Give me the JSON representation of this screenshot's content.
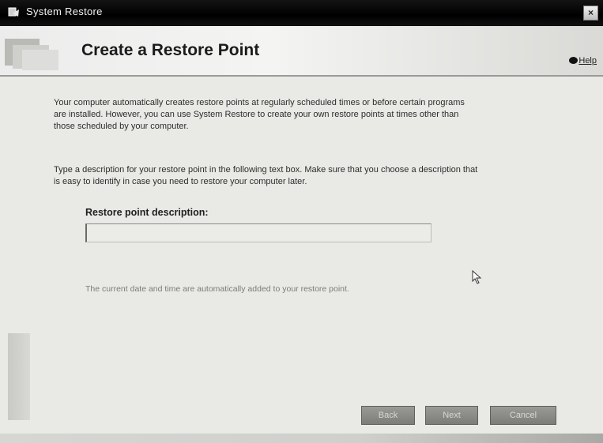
{
  "window": {
    "title": "System Restore",
    "close_label": "×"
  },
  "header": {
    "title": "Create a Restore Point",
    "help_label": "Help"
  },
  "main": {
    "intro_text": "Your computer automatically creates restore points at regularly scheduled times or before certain programs are installed. However, you can use System Restore to create your own restore points at times other than those scheduled by your computer.",
    "instructions_text": "Type a description for your restore point in the following text box. Make sure that you choose a description that is easy to identify in case you need to restore your computer later.",
    "field_label": "Restore point description:",
    "field_value": "",
    "hint_text": "The current date and time are automatically added to your restore point."
  },
  "buttons": {
    "back_label": "Back",
    "next_label": "Next",
    "cancel_label": "Cancel"
  },
  "icons": {
    "app": "system-restore-icon",
    "help": "help-icon",
    "cursor": "mouse-pointer-icon"
  }
}
